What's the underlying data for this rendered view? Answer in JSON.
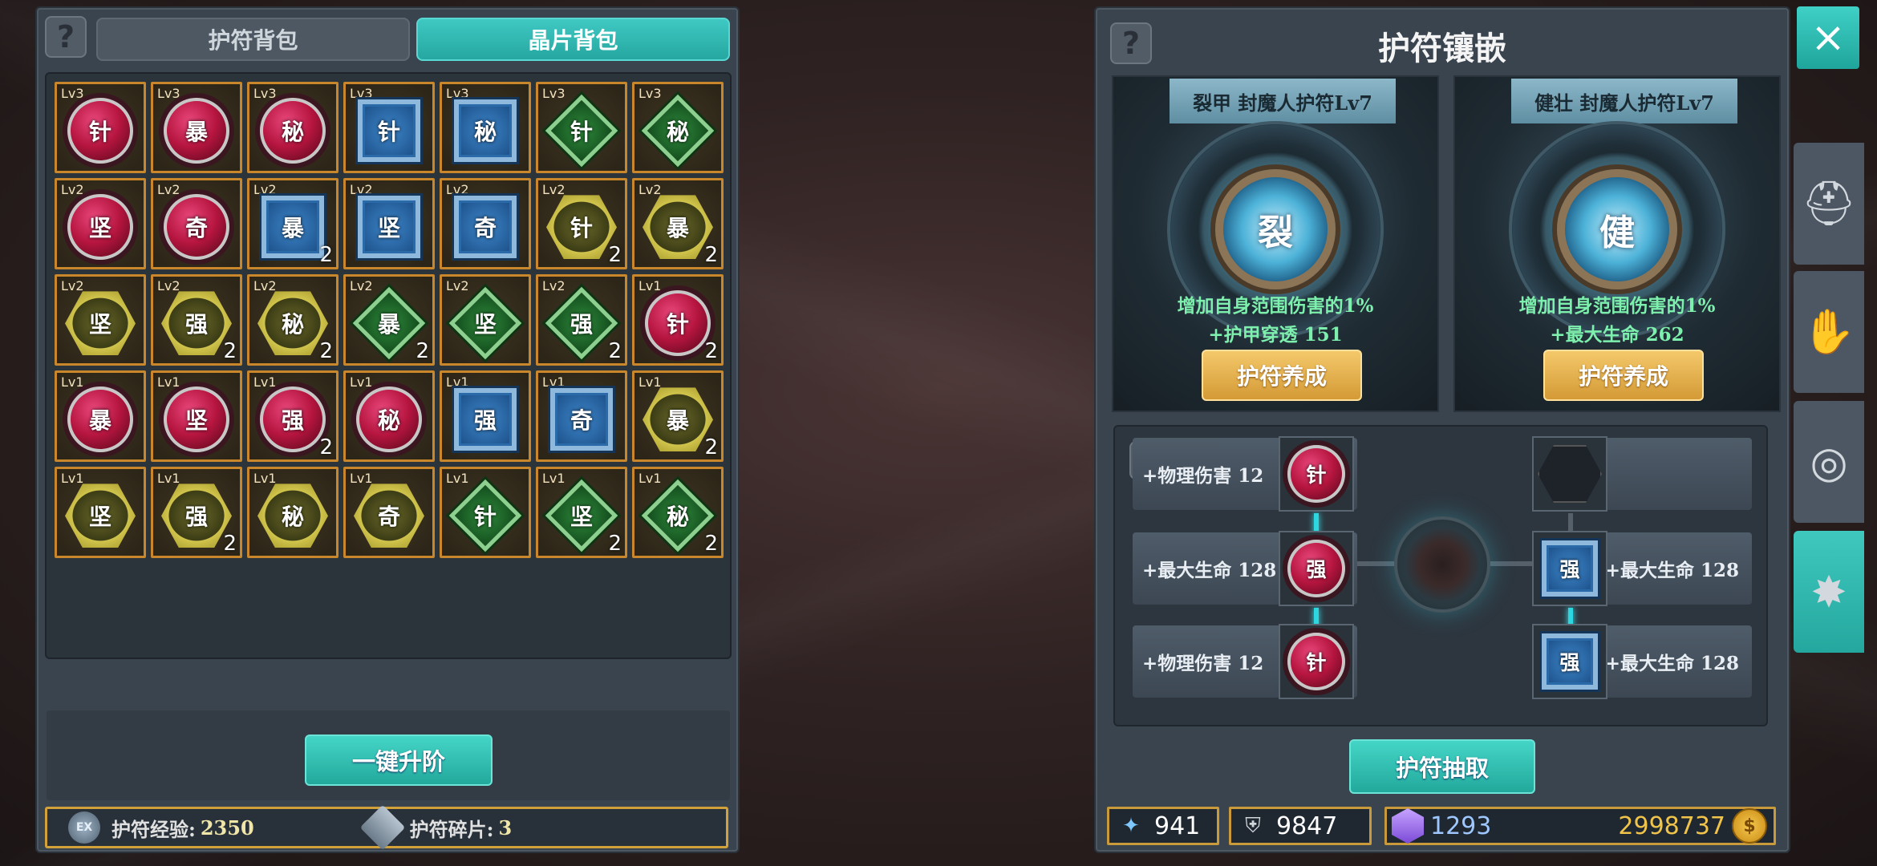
{
  "left_panel": {
    "tabs": [
      {
        "label": "护符背包",
        "active": false
      },
      {
        "label": "晶片背包",
        "active": true
      }
    ],
    "grid": [
      {
        "lv": "Lv3",
        "char": "针",
        "shape": "red",
        "count": ""
      },
      {
        "lv": "Lv3",
        "char": "暴",
        "shape": "red",
        "count": ""
      },
      {
        "lv": "Lv3",
        "char": "秘",
        "shape": "red",
        "count": ""
      },
      {
        "lv": "Lv3",
        "char": "针",
        "shape": "blue",
        "count": ""
      },
      {
        "lv": "Lv3",
        "char": "秘",
        "shape": "blue",
        "count": ""
      },
      {
        "lv": "Lv3",
        "char": "针",
        "shape": "green",
        "count": ""
      },
      {
        "lv": "Lv3",
        "char": "秘",
        "shape": "green",
        "count": ""
      },
      {
        "lv": "Lv2",
        "char": "坚",
        "shape": "red",
        "count": ""
      },
      {
        "lv": "Lv2",
        "char": "奇",
        "shape": "red",
        "count": ""
      },
      {
        "lv": "Lv2",
        "char": "暴",
        "shape": "blue",
        "count": "2"
      },
      {
        "lv": "Lv2",
        "char": "坚",
        "shape": "blue",
        "count": ""
      },
      {
        "lv": "Lv2",
        "char": "奇",
        "shape": "blue",
        "count": ""
      },
      {
        "lv": "Lv2",
        "char": "针",
        "shape": "gold",
        "count": "2"
      },
      {
        "lv": "Lv2",
        "char": "暴",
        "shape": "gold",
        "count": "2"
      },
      {
        "lv": "Lv2",
        "char": "坚",
        "shape": "gold",
        "count": ""
      },
      {
        "lv": "Lv2",
        "char": "强",
        "shape": "gold",
        "count": "2"
      },
      {
        "lv": "Lv2",
        "char": "秘",
        "shape": "gold",
        "count": "2"
      },
      {
        "lv": "Lv2",
        "char": "暴",
        "shape": "green",
        "count": "2"
      },
      {
        "lv": "Lv2",
        "char": "坚",
        "shape": "green",
        "count": ""
      },
      {
        "lv": "Lv2",
        "char": "强",
        "shape": "green",
        "count": "2"
      },
      {
        "lv": "Lv1",
        "char": "针",
        "shape": "red",
        "count": "2"
      },
      {
        "lv": "Lv1",
        "char": "暴",
        "shape": "red",
        "count": ""
      },
      {
        "lv": "Lv1",
        "char": "坚",
        "shape": "red",
        "count": ""
      },
      {
        "lv": "Lv1",
        "char": "强",
        "shape": "red",
        "count": "2"
      },
      {
        "lv": "Lv1",
        "char": "秘",
        "shape": "red",
        "count": ""
      },
      {
        "lv": "Lv1",
        "char": "强",
        "shape": "blue",
        "count": ""
      },
      {
        "lv": "Lv1",
        "char": "奇",
        "shape": "blue",
        "count": ""
      },
      {
        "lv": "Lv1",
        "char": "暴",
        "shape": "gold",
        "count": "2"
      },
      {
        "lv": "Lv1",
        "char": "坚",
        "shape": "gold",
        "count": ""
      },
      {
        "lv": "Lv1",
        "char": "强",
        "shape": "gold",
        "count": "2"
      },
      {
        "lv": "Lv1",
        "char": "秘",
        "shape": "gold",
        "count": ""
      },
      {
        "lv": "Lv1",
        "char": "奇",
        "shape": "gold",
        "count": ""
      },
      {
        "lv": "Lv1",
        "char": "针",
        "shape": "green",
        "count": ""
      },
      {
        "lv": "Lv1",
        "char": "坚",
        "shape": "green",
        "count": "2"
      },
      {
        "lv": "Lv1",
        "char": "秘",
        "shape": "green",
        "count": "2"
      }
    ],
    "upgrade_button": "一键升阶",
    "exp_icon_text": "EX",
    "exp_label": "护符经验:",
    "exp_value": "2350",
    "shard_label": "护符碎片:",
    "shard_value": "3"
  },
  "right_panel": {
    "title": "护符镶嵌",
    "close_icon": "×",
    "cards": [
      {
        "ribbon": "裂甲  封魔人护符Lv7",
        "core_char": "裂",
        "desc1": "增加自身范围伤害的1%",
        "desc2": "+护甲穿透  151",
        "button": "护符养成"
      },
      {
        "ribbon": "健壮  封魔人护符Lv7",
        "core_char": "健",
        "desc1": "增加自身范围伤害的1%",
        "desc2": "+最大生命  262",
        "button": "护符养成"
      }
    ],
    "sockets": {
      "left": [
        {
          "label": "+物理伤害  12",
          "char": "针",
          "shape": "red"
        },
        {
          "label": "+最大生命  128",
          "char": "强",
          "shape": "red"
        },
        {
          "label": "+物理伤害  12",
          "char": "针",
          "shape": "red"
        }
      ],
      "right": [
        {
          "label": "",
          "char": "",
          "shape": "empty"
        },
        {
          "label": "+最大生命  128",
          "char": "强",
          "shape": "blue"
        },
        {
          "label": "+最大生命  128",
          "char": "强",
          "shape": "blue"
        }
      ]
    },
    "extract_button": "护符抽取",
    "resources": {
      "wand": "941",
      "shield": "9847",
      "crystal": "1293",
      "gold": "2998737"
    },
    "side_tabs": [
      {
        "icon": "helmet-icon",
        "glyph": "⛑",
        "active": false
      },
      {
        "icon": "gloves-icon",
        "glyph": "✋",
        "active": false
      },
      {
        "icon": "target-icon",
        "glyph": "◎",
        "active": false
      },
      {
        "icon": "amulet-icon",
        "glyph": "✸",
        "active": true
      }
    ]
  },
  "colors": {
    "accent_teal": "#2fbdb3",
    "gold_button": "#e2ae4c",
    "slot_border": "#c9862a",
    "green_text": "#7ef0ad"
  }
}
